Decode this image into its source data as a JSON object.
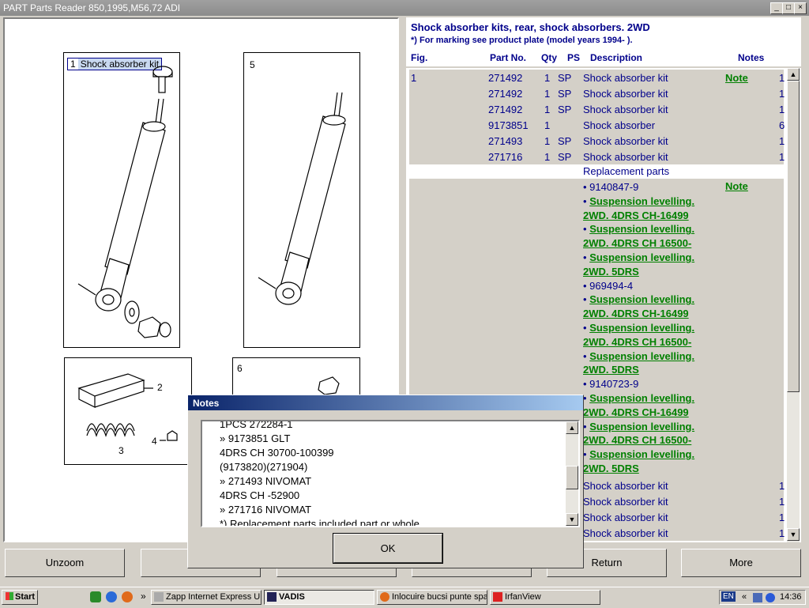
{
  "window": {
    "title": "PART Parts Reader 850,1995,M56,72 ADI",
    "btn_min": "_",
    "btn_max": "□",
    "btn_close": "×"
  },
  "figures": {
    "fig1_num": "1",
    "fig1_label": "Shock absorber kit",
    "fig5_label": "5",
    "fig6_label": "6",
    "fig2_label": "2",
    "fig3_label": "3",
    "fig4_label": "4"
  },
  "header": {
    "title": "Shock absorber kits, rear, shock absorbers. 2WD",
    "subtitle": "*) For marking see product plate (model years 1994- ).",
    "columns": {
      "fig": "Fig.",
      "partno": "Part No.",
      "qty": "Qty",
      "ps": "PS",
      "desc": "Description",
      "notes": "Notes"
    }
  },
  "rows": [
    {
      "fig": "1",
      "partno": "271492",
      "qty": "1",
      "ps": "SP",
      "desc": "Shock absorber kit",
      "note": "Note",
      "count": "1"
    },
    {
      "fig": "",
      "partno": "271492",
      "qty": "1",
      "ps": "SP",
      "desc": "Shock absorber kit",
      "note": "",
      "count": "1"
    },
    {
      "fig": "",
      "partno": "271492",
      "qty": "1",
      "ps": "SP",
      "desc": "Shock absorber kit",
      "note": "",
      "count": "1"
    },
    {
      "fig": "",
      "partno": "9173851",
      "qty": "1",
      "ps": "",
      "desc": "Shock absorber",
      "note": "",
      "count": "6"
    },
    {
      "fig": "",
      "partno": "271493",
      "qty": "1",
      "ps": "SP",
      "desc": "Shock absorber kit",
      "note": "",
      "count": "1"
    },
    {
      "fig": "",
      "partno": "271716",
      "qty": "1",
      "ps": "SP",
      "desc": "Shock absorber kit",
      "note": "",
      "count": "1"
    }
  ],
  "replacement_label": "Replacement parts",
  "replacement": {
    "p1": "• 9140847-9",
    "p1_note": "Note",
    "l1a": "Suspension levelling.",
    "l1b": "2WD. 4DRS CH-16499",
    "l2a": "Suspension levelling.",
    "l2b": "2WD. 4DRS CH 16500-",
    "l3a": "Suspension levelling.",
    "l3b": "2WD. 5DRS",
    "p2": "• 969494-4",
    "l4a": "Suspension levelling.",
    "l4b": "2WD. 4DRS CH-16499",
    "l5a": "Suspension levelling.",
    "l5b": "2WD. 4DRS CH 16500-",
    "l6a": "Suspension levelling.",
    "l6b": "2WD. 5DRS",
    "p3": "• 9140723-9",
    "l7a": "Suspension levelling.",
    "l7b": "2WD. 4DRS CH-16499",
    "l8a": "Suspension levelling.",
    "l8b": "2WD. 4DRS CH 16500-",
    "l9a": "Suspension levelling.",
    "l9b": "2WD. 5DRS"
  },
  "bullet": "•",
  "bottom_rows": [
    {
      "desc": "Shock absorber kit",
      "count": "1"
    },
    {
      "desc": "Shock absorber kit",
      "count": "1"
    },
    {
      "desc": "Shock absorber kit",
      "count": "1"
    },
    {
      "desc": "Shock absorber kit",
      "count": "1"
    }
  ],
  "buttons": {
    "unzoom": "Unzoom",
    "return": "Return",
    "more": "More",
    "ok": "OK"
  },
  "dialog": {
    "title": "Notes",
    "lines": [
      "1PCS 272284-1",
      "» 9173851 GLT",
      "4DRS CH 30700-100399",
      "(9173820)(271904)",
      "» 271493 NIVOMAT",
      "4DRS CH -52900",
      "» 271716 NIVOMAT",
      "*) Replacement parts included part or whole"
    ]
  },
  "taskbar": {
    "start": "Start",
    "chevron": "»",
    "items": [
      "Zapp Internet Express U...",
      "VADIS",
      "Inlocuire bucsi punte spa...",
      "IrfanView"
    ],
    "lang": "EN",
    "tray_chevron": "«",
    "time": "14:36"
  }
}
